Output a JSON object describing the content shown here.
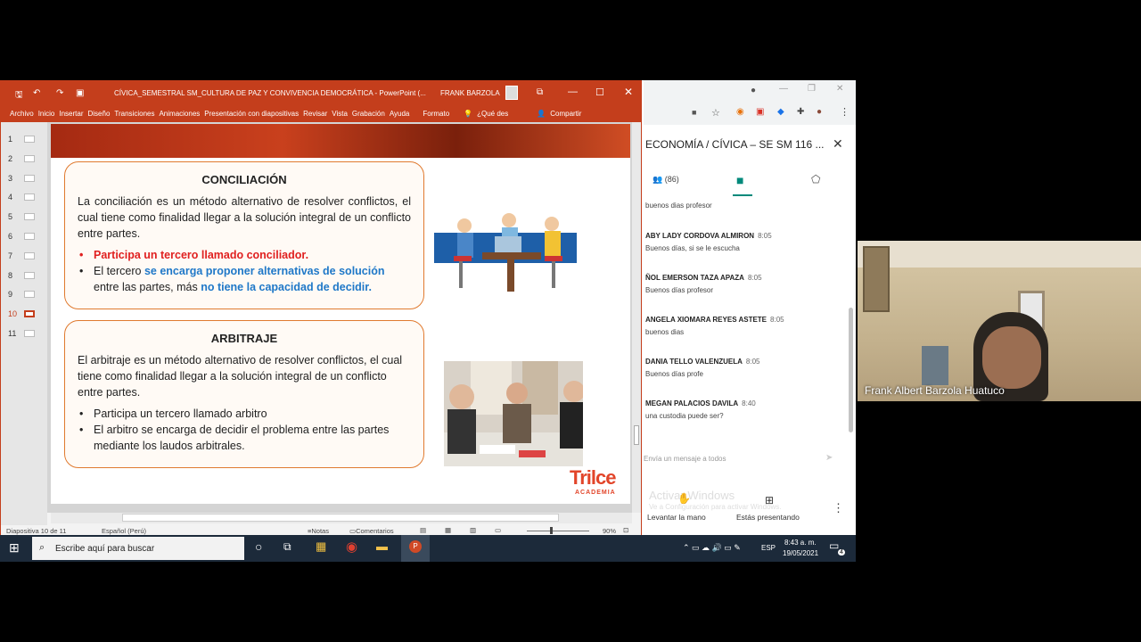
{
  "ppt": {
    "title": "CÍVICA_SEMESTRAL SM_CULTURA DE PAZ Y CONVIVENCIA DEMOCRÁTICA - PowerPoint (...",
    "user": "FRANK BARZOLA",
    "menu": [
      "Archivo",
      "Inicio",
      "Insertar",
      "Diseño",
      "Transiciones",
      "Animaciones",
      "Presentación con diapositivas",
      "Revisar",
      "Vista",
      "Grabación",
      "Ayuda",
      "Formato"
    ],
    "tell_me": "¿Qué des",
    "share": "Compartir",
    "thumb_numbers": [
      "1",
      "2",
      "3",
      "4",
      "5",
      "6",
      "7",
      "8",
      "9",
      "10",
      "11"
    ],
    "status_slide": "Diapositiva 10 de 11",
    "status_lang": "Español (Perú)",
    "notes": "Notas",
    "comments": "Comentarios",
    "zoom": "90%"
  },
  "slide": {
    "box1": {
      "title": "CONCILIACIÓN",
      "paragraph": "La conciliación es un método alternativo de resolver conflictos, el cual tiene como finalidad llegar a la solución integral de un conflicto entre partes.",
      "bullet1": "Participa un tercero llamado conciliador.",
      "bullet2_a": "El tercero ",
      "bullet2_b": "se encarga proponer alternativas de solución",
      "bullet2_c": " entre las partes, más ",
      "bullet2_d": "no tiene la capacidad de decidir."
    },
    "box2": {
      "title": "ARBITRAJE",
      "paragraph": "El arbitraje es un método alternativo de resolver conflictos, el cual tiene como finalidad llegar a la solución integral de un conflicto entre partes.",
      "bullet1": "Participa un tercero llamado arbitro",
      "bullet2": "El arbitro se encarga de decidir el problema entre las partes mediante los laudos arbitrales."
    },
    "logo_main": "Trilce",
    "logo_sub": "ACADEMIA"
  },
  "meet": {
    "title": "ECONOMÍA / CÍVICA – SE SM 116 ...",
    "participants": "(86)",
    "messages": [
      {
        "name": "",
        "time": "",
        "text": "buenos dias profesor"
      },
      {
        "name": "ABY LADY CORDOVA ALMIRON",
        "time": "8:05",
        "text": "Buenos días, si se le escucha"
      },
      {
        "name": "ÑOL EMERSON TAZA APAZA",
        "time": "8:05",
        "text": "Buenos días profesor"
      },
      {
        "name": "ANGELA XIOMARA REYES ASTETE",
        "time": "8:05",
        "text": "buenos dias"
      },
      {
        "name": "DANIA TELLO VALENZUELA",
        "time": "8:05",
        "text": "Buenos días profe"
      },
      {
        "name": "MEGAN PALACIOS DAVILA",
        "time": "8:40",
        "text": "una custodia puede ser?"
      }
    ],
    "input_placeholder": "Envía un mensaje a todos",
    "raise_hand": "Levantar la mano",
    "presenting": "Estás presentando",
    "watermark1": "Activar Windows",
    "watermark2": "Ve a Configuración para activar Windows."
  },
  "taskbar": {
    "search_placeholder": "Escribe aquí para buscar",
    "time": "8:43 a. m.",
    "date": "19/05/2021",
    "lang": "ESP",
    "notif": "4"
  },
  "camera": {
    "name": "Frank Albert Barzola Huatuco"
  },
  "colors": {
    "ppt_accent": "#c43e1c",
    "meet_accent": "#00897b",
    "red_text": "#e02020",
    "blue_text": "#1f78c8",
    "box_border": "#e07a2f"
  }
}
